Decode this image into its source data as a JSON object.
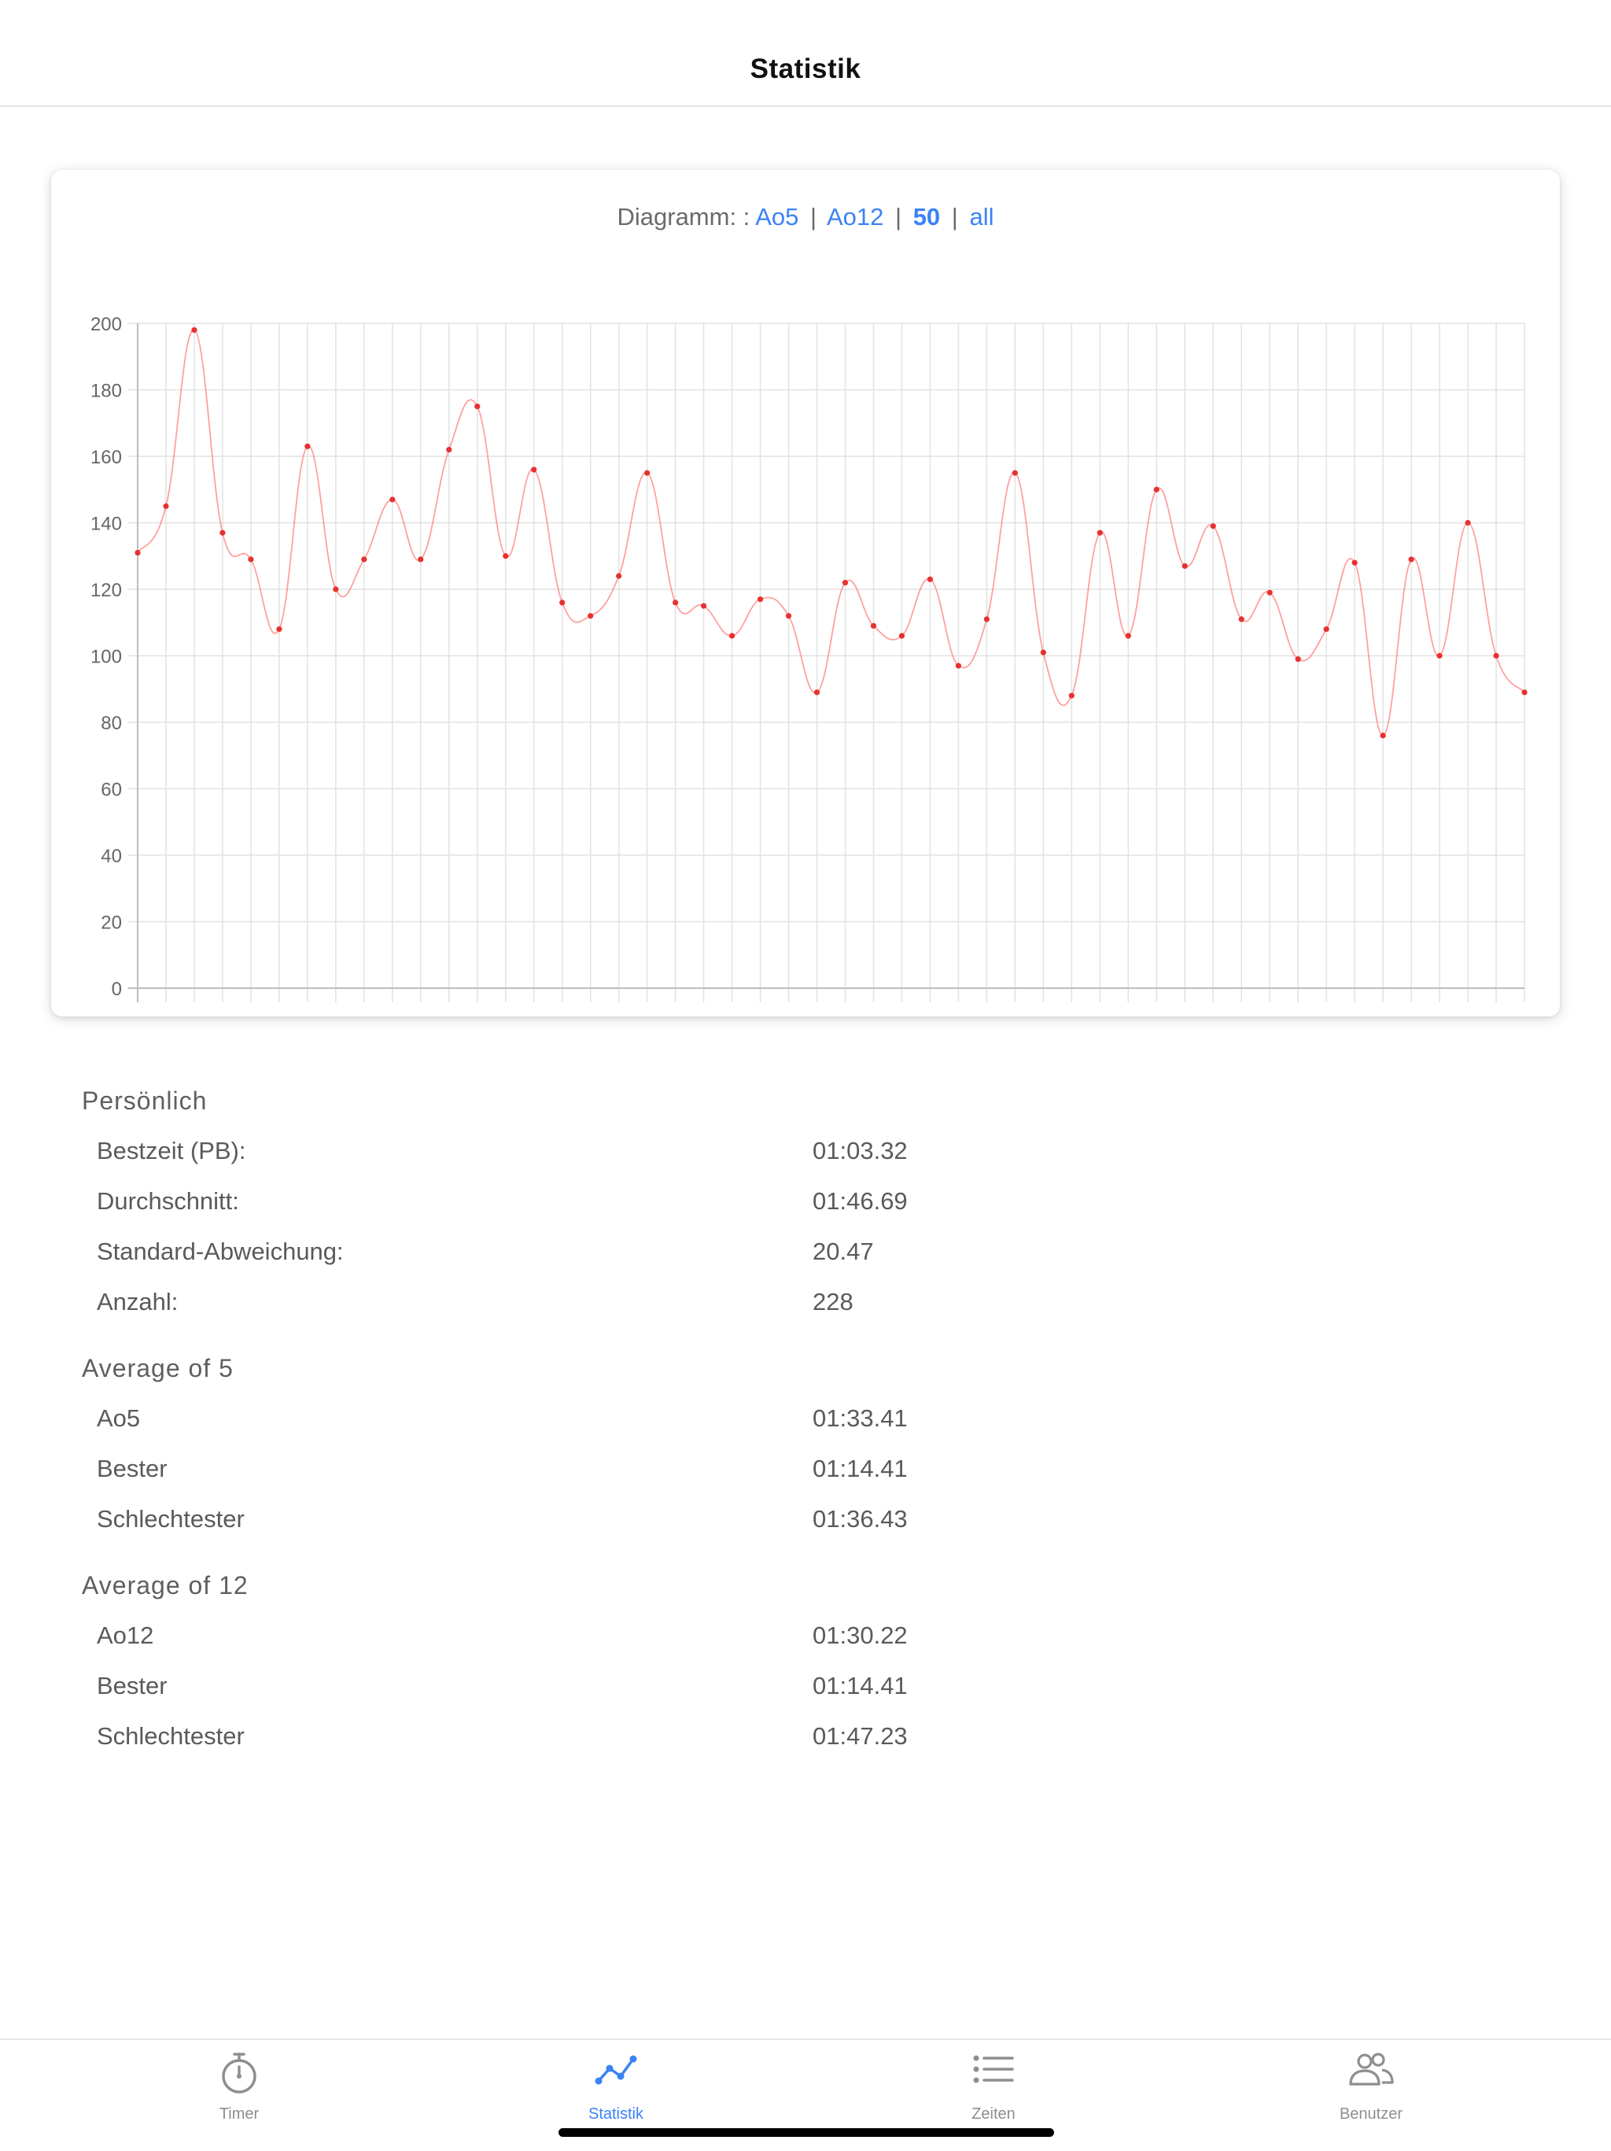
{
  "header": {
    "title": "Statistik"
  },
  "diagram_switch": {
    "prefix": "Diagramm: :",
    "sep": "|",
    "options": [
      "Ao5",
      "Ao12",
      "50",
      "all"
    ],
    "active": "50",
    "link_color": "#3b82f6"
  },
  "chart_data": {
    "type": "line",
    "title": "",
    "xlabel": "",
    "ylabel": "",
    "ylim": [
      0,
      200
    ],
    "yticks": [
      0,
      20,
      40,
      60,
      80,
      100,
      120,
      140,
      160,
      180,
      200
    ],
    "grid": true,
    "legend": "none",
    "line_color": "#ff8080",
    "point_color": "#e83030",
    "series": [
      {
        "values": [
          131,
          145,
          198,
          137,
          129,
          108,
          163,
          120,
          129,
          147,
          129,
          162,
          175,
          130,
          156,
          116,
          112,
          124,
          155,
          116,
          115,
          106,
          117,
          112,
          89,
          122,
          109,
          106,
          123,
          97,
          111,
          155,
          101,
          88,
          137,
          106,
          150,
          127,
          139,
          111,
          119,
          99,
          108,
          128,
          76,
          129,
          100,
          140,
          100,
          89
        ]
      }
    ]
  },
  "stats": {
    "personal": {
      "title": "Persönlich",
      "rows": [
        {
          "label": "Bestzeit (PB):",
          "value": "01:03.32"
        },
        {
          "label": "Durchschnitt:",
          "value": "01:46.69"
        },
        {
          "label": "Standard-Abweichung:",
          "value": "20.47"
        },
        {
          "label": "Anzahl:",
          "value": "228"
        }
      ]
    },
    "ao5": {
      "title": "Average of 5",
      "rows": [
        {
          "label": "Ao5",
          "value": "01:33.41"
        },
        {
          "label": "Bester",
          "value": "01:14.41"
        },
        {
          "label": "Schlechtester",
          "value": "01:36.43"
        }
      ]
    },
    "ao12": {
      "title": "Average of 12",
      "rows": [
        {
          "label": "Ao12",
          "value": "01:30.22"
        },
        {
          "label": "Bester",
          "value": "01:14.41"
        },
        {
          "label": "Schlechtester",
          "value": "01:47.23"
        }
      ]
    }
  },
  "tabbar": {
    "active": "Statistik",
    "active_color": "#3b82f6",
    "items": [
      {
        "label": "Timer",
        "icon": "stopwatch-icon"
      },
      {
        "label": "Statistik",
        "icon": "line-chart-icon"
      },
      {
        "label": "Zeiten",
        "icon": "list-icon"
      },
      {
        "label": "Benutzer",
        "icon": "users-icon"
      }
    ]
  }
}
